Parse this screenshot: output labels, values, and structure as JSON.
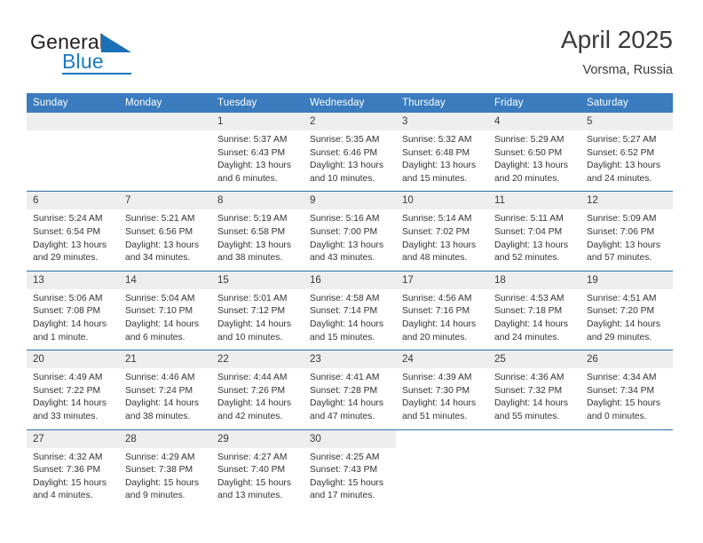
{
  "brand": {
    "name_primary": "General",
    "name_secondary": "Blue",
    "logo_icon": "triangle-logo-icon"
  },
  "header": {
    "title": "April 2025",
    "subtitle": "Vorsma, Russia"
  },
  "calendar": {
    "weekday_headers": [
      "Sunday",
      "Monday",
      "Tuesday",
      "Wednesday",
      "Thursday",
      "Friday",
      "Saturday"
    ],
    "accent_color": "#3a7cbe",
    "row_divider_color": "#2e6da4",
    "daynum_band_color": "#eeeeee",
    "weeks": [
      [
        {
          "day": "",
          "blank": true
        },
        {
          "day": "",
          "blank": true
        },
        {
          "day": "1",
          "sunrise": "Sunrise: 5:37 AM",
          "sunset": "Sunset: 6:43 PM",
          "daylight_line1": "Daylight: 13 hours",
          "daylight_line2": "and 6 minutes."
        },
        {
          "day": "2",
          "sunrise": "Sunrise: 5:35 AM",
          "sunset": "Sunset: 6:46 PM",
          "daylight_line1": "Daylight: 13 hours",
          "daylight_line2": "and 10 minutes."
        },
        {
          "day": "3",
          "sunrise": "Sunrise: 5:32 AM",
          "sunset": "Sunset: 6:48 PM",
          "daylight_line1": "Daylight: 13 hours",
          "daylight_line2": "and 15 minutes."
        },
        {
          "day": "4",
          "sunrise": "Sunrise: 5:29 AM",
          "sunset": "Sunset: 6:50 PM",
          "daylight_line1": "Daylight: 13 hours",
          "daylight_line2": "and 20 minutes."
        },
        {
          "day": "5",
          "sunrise": "Sunrise: 5:27 AM",
          "sunset": "Sunset: 6:52 PM",
          "daylight_line1": "Daylight: 13 hours",
          "daylight_line2": "and 24 minutes."
        }
      ],
      [
        {
          "day": "6",
          "sunrise": "Sunrise: 5:24 AM",
          "sunset": "Sunset: 6:54 PM",
          "daylight_line1": "Daylight: 13 hours",
          "daylight_line2": "and 29 minutes."
        },
        {
          "day": "7",
          "sunrise": "Sunrise: 5:21 AM",
          "sunset": "Sunset: 6:56 PM",
          "daylight_line1": "Daylight: 13 hours",
          "daylight_line2": "and 34 minutes."
        },
        {
          "day": "8",
          "sunrise": "Sunrise: 5:19 AM",
          "sunset": "Sunset: 6:58 PM",
          "daylight_line1": "Daylight: 13 hours",
          "daylight_line2": "and 38 minutes."
        },
        {
          "day": "9",
          "sunrise": "Sunrise: 5:16 AM",
          "sunset": "Sunset: 7:00 PM",
          "daylight_line1": "Daylight: 13 hours",
          "daylight_line2": "and 43 minutes."
        },
        {
          "day": "10",
          "sunrise": "Sunrise: 5:14 AM",
          "sunset": "Sunset: 7:02 PM",
          "daylight_line1": "Daylight: 13 hours",
          "daylight_line2": "and 48 minutes."
        },
        {
          "day": "11",
          "sunrise": "Sunrise: 5:11 AM",
          "sunset": "Sunset: 7:04 PM",
          "daylight_line1": "Daylight: 13 hours",
          "daylight_line2": "and 52 minutes."
        },
        {
          "day": "12",
          "sunrise": "Sunrise: 5:09 AM",
          "sunset": "Sunset: 7:06 PM",
          "daylight_line1": "Daylight: 13 hours",
          "daylight_line2": "and 57 minutes."
        }
      ],
      [
        {
          "day": "13",
          "sunrise": "Sunrise: 5:06 AM",
          "sunset": "Sunset: 7:08 PM",
          "daylight_line1": "Daylight: 14 hours",
          "daylight_line2": "and 1 minute."
        },
        {
          "day": "14",
          "sunrise": "Sunrise: 5:04 AM",
          "sunset": "Sunset: 7:10 PM",
          "daylight_line1": "Daylight: 14 hours",
          "daylight_line2": "and 6 minutes."
        },
        {
          "day": "15",
          "sunrise": "Sunrise: 5:01 AM",
          "sunset": "Sunset: 7:12 PM",
          "daylight_line1": "Daylight: 14 hours",
          "daylight_line2": "and 10 minutes."
        },
        {
          "day": "16",
          "sunrise": "Sunrise: 4:58 AM",
          "sunset": "Sunset: 7:14 PM",
          "daylight_line1": "Daylight: 14 hours",
          "daylight_line2": "and 15 minutes."
        },
        {
          "day": "17",
          "sunrise": "Sunrise: 4:56 AM",
          "sunset": "Sunset: 7:16 PM",
          "daylight_line1": "Daylight: 14 hours",
          "daylight_line2": "and 20 minutes."
        },
        {
          "day": "18",
          "sunrise": "Sunrise: 4:53 AM",
          "sunset": "Sunset: 7:18 PM",
          "daylight_line1": "Daylight: 14 hours",
          "daylight_line2": "and 24 minutes."
        },
        {
          "day": "19",
          "sunrise": "Sunrise: 4:51 AM",
          "sunset": "Sunset: 7:20 PM",
          "daylight_line1": "Daylight: 14 hours",
          "daylight_line2": "and 29 minutes."
        }
      ],
      [
        {
          "day": "20",
          "sunrise": "Sunrise: 4:49 AM",
          "sunset": "Sunset: 7:22 PM",
          "daylight_line1": "Daylight: 14 hours",
          "daylight_line2": "and 33 minutes."
        },
        {
          "day": "21",
          "sunrise": "Sunrise: 4:46 AM",
          "sunset": "Sunset: 7:24 PM",
          "daylight_line1": "Daylight: 14 hours",
          "daylight_line2": "and 38 minutes."
        },
        {
          "day": "22",
          "sunrise": "Sunrise: 4:44 AM",
          "sunset": "Sunset: 7:26 PM",
          "daylight_line1": "Daylight: 14 hours",
          "daylight_line2": "and 42 minutes."
        },
        {
          "day": "23",
          "sunrise": "Sunrise: 4:41 AM",
          "sunset": "Sunset: 7:28 PM",
          "daylight_line1": "Daylight: 14 hours",
          "daylight_line2": "and 47 minutes."
        },
        {
          "day": "24",
          "sunrise": "Sunrise: 4:39 AM",
          "sunset": "Sunset: 7:30 PM",
          "daylight_line1": "Daylight: 14 hours",
          "daylight_line2": "and 51 minutes."
        },
        {
          "day": "25",
          "sunrise": "Sunrise: 4:36 AM",
          "sunset": "Sunset: 7:32 PM",
          "daylight_line1": "Daylight: 14 hours",
          "daylight_line2": "and 55 minutes."
        },
        {
          "day": "26",
          "sunrise": "Sunrise: 4:34 AM",
          "sunset": "Sunset: 7:34 PM",
          "daylight_line1": "Daylight: 15 hours",
          "daylight_line2": "and 0 minutes."
        }
      ],
      [
        {
          "day": "27",
          "sunrise": "Sunrise: 4:32 AM",
          "sunset": "Sunset: 7:36 PM",
          "daylight_line1": "Daylight: 15 hours",
          "daylight_line2": "and 4 minutes."
        },
        {
          "day": "28",
          "sunrise": "Sunrise: 4:29 AM",
          "sunset": "Sunset: 7:38 PM",
          "daylight_line1": "Daylight: 15 hours",
          "daylight_line2": "and 9 minutes."
        },
        {
          "day": "29",
          "sunrise": "Sunrise: 4:27 AM",
          "sunset": "Sunset: 7:40 PM",
          "daylight_line1": "Daylight: 15 hours",
          "daylight_line2": "and 13 minutes."
        },
        {
          "day": "30",
          "sunrise": "Sunrise: 4:25 AM",
          "sunset": "Sunset: 7:43 PM",
          "daylight_line1": "Daylight: 15 hours",
          "daylight_line2": "and 17 minutes."
        },
        {
          "day": "",
          "filler": true
        },
        {
          "day": "",
          "filler": true
        },
        {
          "day": "",
          "filler": true
        }
      ]
    ]
  }
}
